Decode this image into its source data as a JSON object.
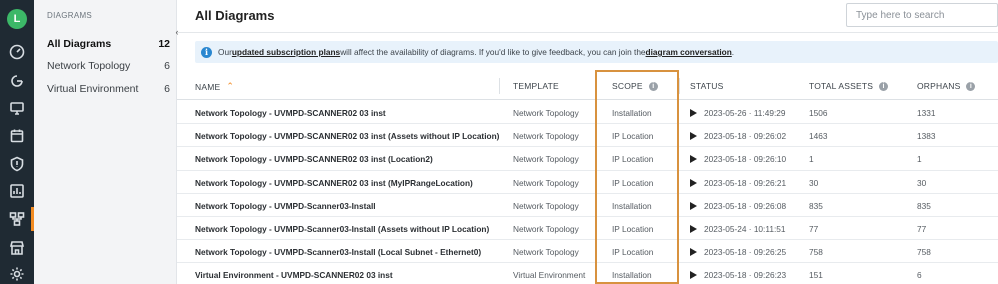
{
  "user": {
    "initial": "L"
  },
  "rail": {
    "icons": [
      "gauge-icon",
      "graph-icon",
      "monitor-icon",
      "calendar-icon",
      "shield-icon",
      "chart-icon",
      "diagram-icon",
      "store-icon",
      "settings-icon"
    ],
    "active_color": "#f28b22"
  },
  "sidebar": {
    "heading": "DIAGRAMS",
    "items": [
      {
        "label": "All Diagrams",
        "count": "12"
      },
      {
        "label": "Network Topology",
        "count": "6"
      },
      {
        "label": "Virtual Environment",
        "count": "6"
      }
    ],
    "collapse_glyph": "‹"
  },
  "header": {
    "title": "All Diagrams",
    "search_placeholder": "Type here to search"
  },
  "banner": {
    "info_glyph": "i",
    "prefix": "Our ",
    "link1": "updated subscription plans",
    "middle": " will affect the availability of diagrams. If you'd like to give feedback, you can join the ",
    "link2": "diagram conversation",
    "suffix": "."
  },
  "table": {
    "columns": {
      "name": "NAME",
      "template": "TEMPLATE",
      "scope": "SCOPE",
      "status": "STATUS",
      "assets": "TOTAL ASSETS",
      "orphans": "ORPHANS"
    },
    "sort_glyph": "⌃",
    "help_glyph": "i",
    "rows": [
      {
        "name": "Network Topology - UVMPD-SCANNER02 03 inst",
        "template": "Network Topology",
        "scope": "Installation",
        "status": "2023-05-26 · 11:49:29",
        "assets": "1506",
        "orphans": "1331"
      },
      {
        "name": "Network Topology - UVMPD-SCANNER02 03 inst (Assets without IP Location)",
        "template": "Network Topology",
        "scope": "IP Location",
        "status": "2023-05-18 · 09:26:02",
        "assets": "1463",
        "orphans": "1383"
      },
      {
        "name": "Network Topology - UVMPD-SCANNER02 03 inst (Location2)",
        "template": "Network Topology",
        "scope": "IP Location",
        "status": "2023-05-18 · 09:26:10",
        "assets": "1",
        "orphans": "1"
      },
      {
        "name": "Network Topology - UVMPD-SCANNER02 03 inst (MyIPRangeLocation)",
        "template": "Network Topology",
        "scope": "IP Location",
        "status": "2023-05-18 · 09:26:21",
        "assets": "30",
        "orphans": "30"
      },
      {
        "name": "Network Topology - UVMPD-Scanner03-Install",
        "template": "Network Topology",
        "scope": "Installation",
        "status": "2023-05-18 · 09:26:08",
        "assets": "835",
        "orphans": "835"
      },
      {
        "name": "Network Topology - UVMPD-Scanner03-Install (Assets without IP Location)",
        "template": "Network Topology",
        "scope": "IP Location",
        "status": "2023-05-24 · 10:11:51",
        "assets": "77",
        "orphans": "77"
      },
      {
        "name": "Network Topology - UVMPD-Scanner03-Install (Local Subnet - Ethernet0)",
        "template": "Network Topology",
        "scope": "IP Location",
        "status": "2023-05-18 · 09:26:25",
        "assets": "758",
        "orphans": "758"
      },
      {
        "name": "Virtual Environment - UVMPD-SCANNER02 03 inst",
        "template": "Virtual Environment",
        "scope": "Installation",
        "status": "2023-05-18 · 09:26:23",
        "assets": "151",
        "orphans": "6"
      }
    ]
  },
  "highlight_color": "#d8923f"
}
